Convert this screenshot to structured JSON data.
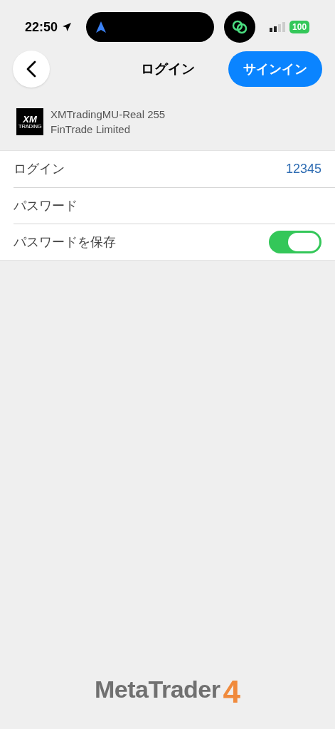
{
  "status_bar": {
    "time": "22:50",
    "battery": "100"
  },
  "nav": {
    "title": "ログイン",
    "action": "サインイン"
  },
  "server": {
    "logo_top": "XM",
    "logo_bottom": "TRADING",
    "name": "XMTradingMU-Real 255",
    "company": "FinTrade Limited"
  },
  "fields": [
    {
      "kind": "value",
      "label": "ログイン",
      "value": "12345"
    },
    {
      "kind": "input",
      "label": "パスワード"
    },
    {
      "kind": "toggle",
      "label": "パスワードを保存",
      "on": true
    }
  ],
  "footer": {
    "brand": "MetaTrader",
    "version": "4"
  }
}
